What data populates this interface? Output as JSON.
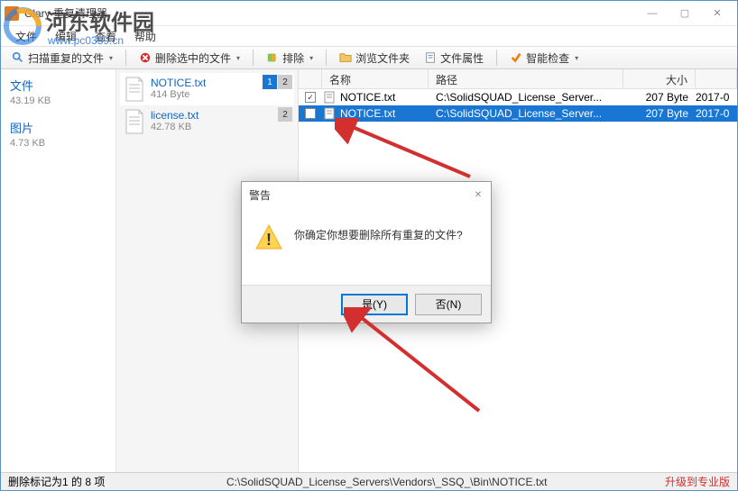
{
  "window": {
    "title": "Glary 重复清理器",
    "min": "—",
    "max": "▢",
    "close": "✕"
  },
  "watermark": {
    "text": "河东软件园",
    "url": "www.pc0359.cn"
  },
  "menu": [
    "文件",
    "编辑",
    "查看",
    "帮助"
  ],
  "toolbar": {
    "scan": "扫描重复的文件",
    "delsel": "删除选中的文件",
    "exclude": "排除",
    "browse": "浏览文件夹",
    "props": "文件属性",
    "smart": "智能检查"
  },
  "sidebar": {
    "cats": [
      {
        "title": "文件",
        "sub": "43.19 KB"
      },
      {
        "title": "图片",
        "sub": "4.73 KB"
      }
    ]
  },
  "mid": {
    "items": [
      {
        "name": "NOTICE.txt",
        "size": "414 Byte",
        "b1": "1",
        "b2": "2",
        "sel": true
      },
      {
        "name": "license.txt",
        "size": "42.78 KB",
        "b2": "2",
        "sel": false
      }
    ]
  },
  "table": {
    "headers": {
      "name": "名称",
      "path": "路径",
      "size": "大小"
    },
    "rows": [
      {
        "checked": true,
        "name": "NOTICE.txt",
        "path": "C:\\SolidSQUAD_License_Server...",
        "size": "207 Byte",
        "date": "2017-0",
        "sel": false
      },
      {
        "checked": false,
        "name": "NOTICE.txt",
        "path": "C:\\SolidSQUAD_License_Server...",
        "size": "207 Byte",
        "date": "2017-0",
        "sel": true
      }
    ]
  },
  "dialog": {
    "title": "警告",
    "msg": "你确定你想要删除所有重复的文件?",
    "yes": "是(Y)",
    "no": "否(N)"
  },
  "status": {
    "left": "删除标记为1 的 8 项",
    "path": "C:\\SolidSQUAD_License_Servers\\Vendors\\_SSQ_\\Bin\\NOTICE.txt",
    "upgrade": "升级到专业版"
  }
}
